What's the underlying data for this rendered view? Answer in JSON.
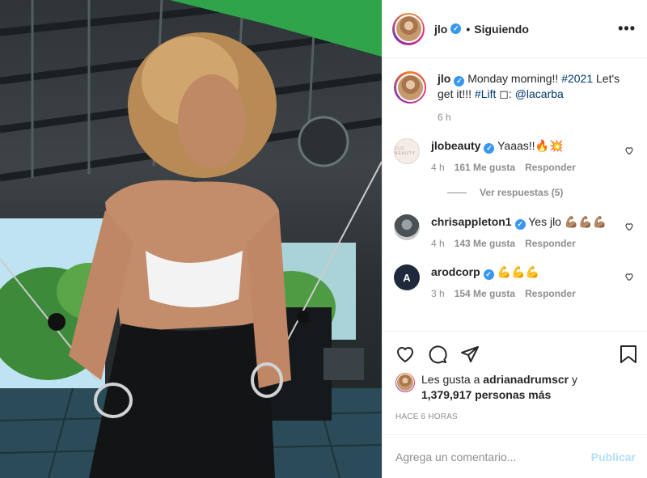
{
  "post": {
    "username": "jlo",
    "follow_status": "Siguiendo",
    "caption_text": "Monday morning!! ",
    "caption_tag1": "#2021",
    "caption_mid": " Let's get it!!! ",
    "caption_tag2": "#Lift",
    "caption_photo": " ◻: ",
    "caption_mention": "@lacarba",
    "caption_time": "6 h"
  },
  "comments": [
    {
      "user": "jlobeauty",
      "text": "Yaaas!!🔥💥",
      "time": "4 h",
      "likes": "161 Me gusta",
      "reply": "Responder",
      "replies_label": "Ver respuestas (5)",
      "avatar_text": "JLO BEAUTY"
    },
    {
      "user": "chrisappleton1",
      "text": "Yes jlo 💪🏽💪🏽💪🏽",
      "time": "4 h",
      "likes": "143 Me gusta",
      "reply": "Responder"
    },
    {
      "user": "arodcorp",
      "text": "💪💪💪",
      "time": "3 h",
      "likes": "154 Me gusta",
      "reply": "Responder",
      "avatar_text": "A"
    }
  ],
  "likes": {
    "prefix": "Les gusta a ",
    "user": "adrianadrumscr",
    "suffix": " y",
    "count": "1,379,917 personas más"
  },
  "posted_time": "HACE 6 HORAS",
  "comment_input": {
    "placeholder": "Agrega un comentario...",
    "publish": "Publicar"
  },
  "icons": {
    "verified": "✓",
    "more": "•••",
    "like": "heart-icon",
    "comment": "comment-icon",
    "share": "share-icon",
    "save": "bookmark-icon"
  },
  "colors": {
    "link": "#00376b",
    "verified": "#3897f0",
    "muted": "#8e8e8e",
    "publish_disabled": "#b2dffc"
  }
}
